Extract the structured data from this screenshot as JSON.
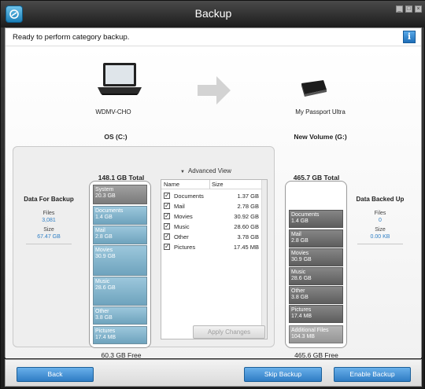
{
  "window": {
    "title": "Backup",
    "controls": [
      "_",
      "□",
      "×"
    ]
  },
  "status": {
    "text": "Ready to perform category backup.",
    "info_icon": "i"
  },
  "source": {
    "computer_name": "WDMV-CHO",
    "volume": "OS (C:)",
    "total": "148.1 GB Total",
    "free": "60.3 GB Free",
    "panel_title": "Data For Backup",
    "files_label": "Files",
    "files_value": "3,081",
    "size_label": "Size",
    "size_value": "67.47 GB",
    "segments": [
      {
        "name": "System",
        "size": "20.3 GB"
      },
      {
        "name": "Documents",
        "size": "1.4 GB"
      },
      {
        "name": "Mail",
        "size": "2.8 GB"
      },
      {
        "name": "Movies",
        "size": "30.9 GB"
      },
      {
        "name": "Music",
        "size": "28.6 GB"
      },
      {
        "name": "Other",
        "size": "3.8 GB"
      },
      {
        "name": "Pictures",
        "size": "17.4 MB"
      }
    ]
  },
  "destination": {
    "drive_name": "My Passport Ultra",
    "volume": "New Volume (G:)",
    "total": "465.7 GB Total",
    "free": "465.6 GB Free",
    "panel_title": "Data Backed Up",
    "files_label": "Files",
    "files_value": "0",
    "size_label": "Size",
    "size_value": "0.00 KB",
    "segments": [
      {
        "name": "Documents",
        "size": "1.4 GB"
      },
      {
        "name": "Mail",
        "size": "2.8 GB"
      },
      {
        "name": "Movies",
        "size": "30.9 GB"
      },
      {
        "name": "Music",
        "size": "28.6 GB"
      },
      {
        "name": "Other",
        "size": "3.8 GB"
      },
      {
        "name": "Pictures",
        "size": "17.4 MB"
      },
      {
        "name": "Additional Files",
        "size": "104.3 MB"
      }
    ]
  },
  "advanced": {
    "toggle_label": "Advanced View",
    "col_name": "Name",
    "col_size": "Size",
    "rows": [
      {
        "name": "Documents",
        "size": "1.37 GB"
      },
      {
        "name": "Mail",
        "size": "2.78 GB"
      },
      {
        "name": "Movies",
        "size": "30.92 GB"
      },
      {
        "name": "Music",
        "size": "28.60 GB"
      },
      {
        "name": "Other",
        "size": "3.78 GB"
      },
      {
        "name": "Pictures",
        "size": "17.45 MB"
      }
    ],
    "apply_label": "Apply Changes"
  },
  "footer": {
    "back": "Back",
    "skip": "Skip Backup",
    "enable": "Enable Backup"
  },
  "colors": {
    "accent": "#2f7cc4",
    "segment_blue": "#7fb1c9",
    "segment_gray": "#7b7b7b",
    "title_bar": "#2a2a2a"
  }
}
